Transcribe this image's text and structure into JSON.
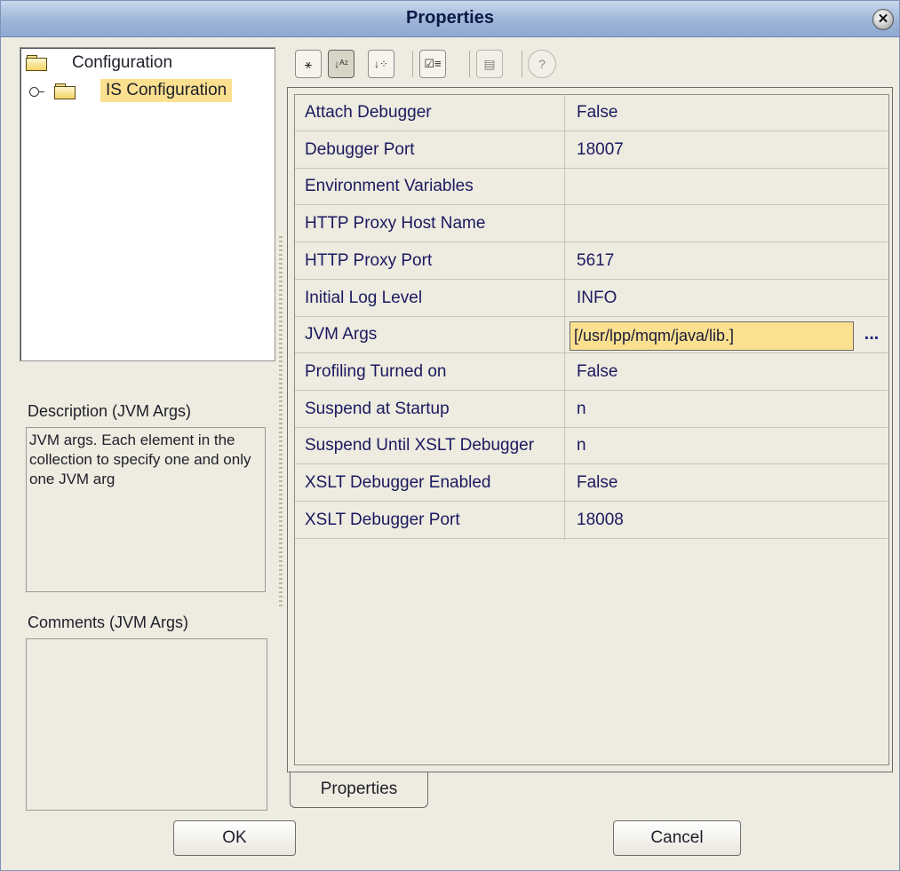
{
  "window": {
    "title": "Properties"
  },
  "tree": {
    "root_label": "Configuration",
    "child_label": "IS Configuration"
  },
  "description": {
    "label": "Description (JVM Args)",
    "text": "JVM args. Each element in the collection to specify one and only one JVM arg"
  },
  "comments": {
    "label": "Comments (JVM Args)",
    "text": ""
  },
  "toolbar": {
    "buttons": [
      {
        "icon": "categorized-icon",
        "glyph": "⚹"
      },
      {
        "icon": "sort-alpha-icon",
        "glyph": "↓ᴬᶻ"
      },
      {
        "icon": "sort-category-icon",
        "glyph": "↓⁘"
      },
      {
        "icon": "checklist-icon",
        "glyph": "☑≡"
      },
      {
        "icon": "property-pages-icon",
        "glyph": "▤"
      },
      {
        "icon": "help-icon",
        "glyph": "?"
      }
    ]
  },
  "properties": [
    {
      "name": "Attach Debugger",
      "value": "False"
    },
    {
      "name": "Debugger Port",
      "value": "18007"
    },
    {
      "name": "Environment Variables",
      "value": ""
    },
    {
      "name": "HTTP Proxy Host Name",
      "value": ""
    },
    {
      "name": "HTTP Proxy Port",
      "value": "5617"
    },
    {
      "name": "Initial Log Level",
      "value": "INFO"
    },
    {
      "name": "JVM Args",
      "value": "[/usr/lpp/mqm/java/lib.]"
    },
    {
      "name": "Profiling Turned on",
      "value": "False"
    },
    {
      "name": "Suspend at Startup",
      "value": "n"
    },
    {
      "name": "Suspend Until XSLT Debugger",
      "value": "n"
    },
    {
      "name": "XSLT Debugger Enabled",
      "value": "False"
    },
    {
      "name": "XSLT Debugger Port",
      "value": "18008"
    }
  ],
  "jvm_ellipsis": "...",
  "tabs": {
    "properties": "Properties"
  },
  "buttons": {
    "ok": "OK",
    "cancel": "Cancel"
  },
  "colors": {
    "titlebar": "#9fb6d8",
    "selection": "#fbe08f",
    "panel": "#eeebe0"
  }
}
